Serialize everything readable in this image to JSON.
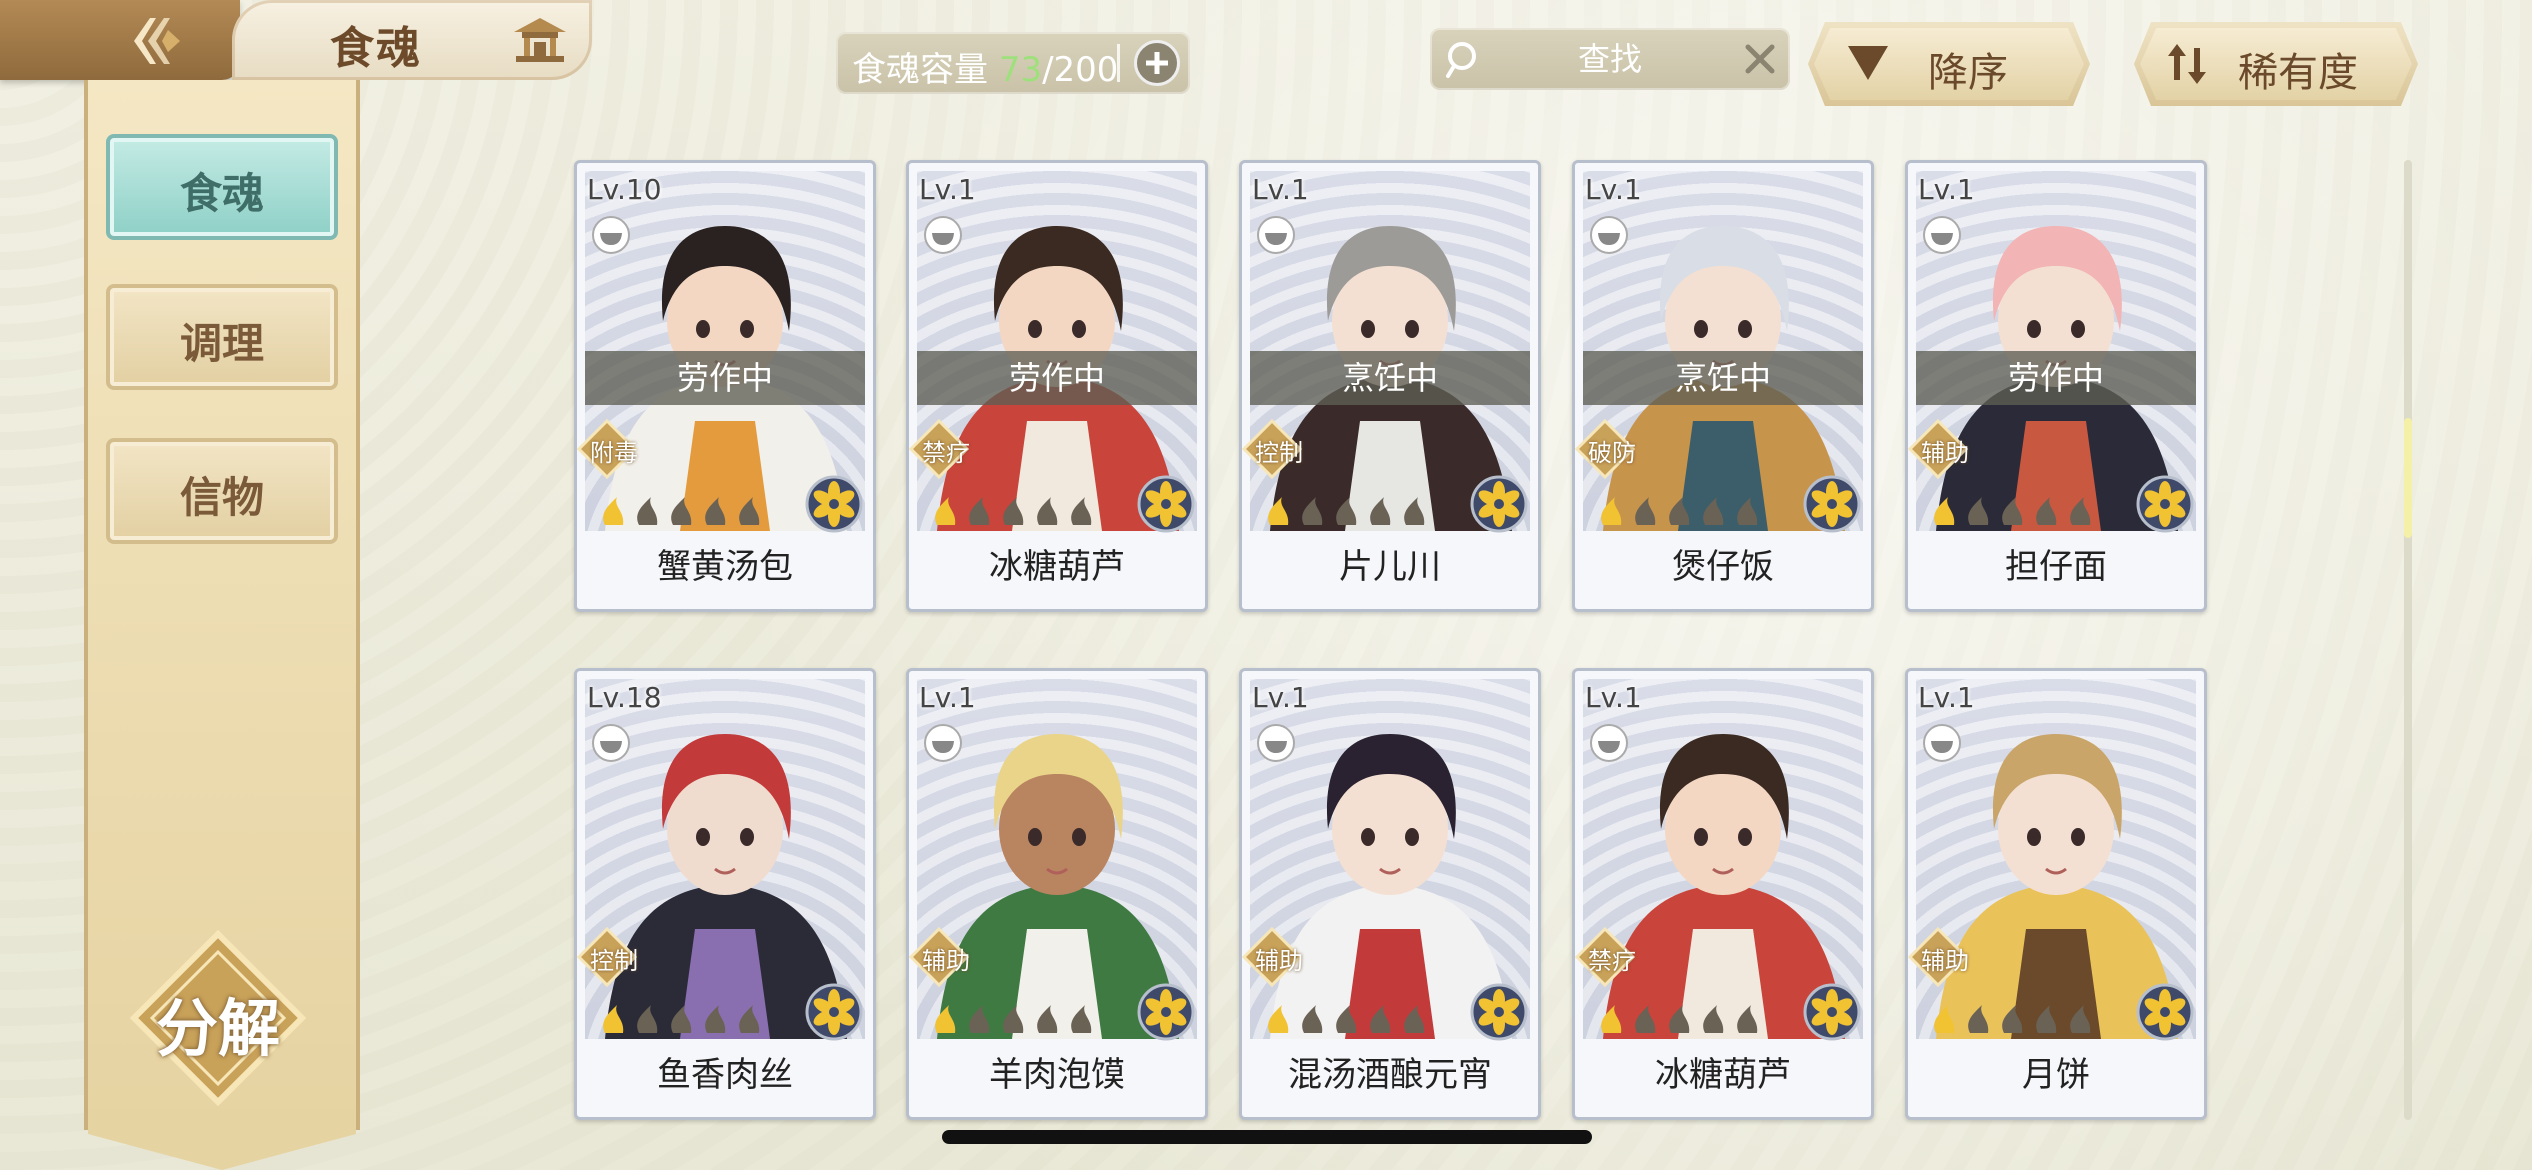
{
  "header": {
    "title": "食魂",
    "capacity_label": "食魂容量",
    "capacity_current": "73",
    "capacity_max": "/200",
    "search_placeholder": "查找",
    "sort_order_label": "降序",
    "sort_rarity_label": "稀有度"
  },
  "sidebar": {
    "items": [
      {
        "label": "食魂",
        "active": true
      },
      {
        "label": "调理",
        "active": false
      },
      {
        "label": "信物",
        "active": false
      }
    ],
    "decompose_label": "分解"
  },
  "cards": [
    {
      "level": "Lv.10",
      "name": "蟹黄汤包",
      "status": "劳作中",
      "role": "附毒",
      "stars": 1,
      "palette": [
        "#f2f0ea",
        "#e49b3e",
        "#2a2220",
        "#f4d7c2"
      ]
    },
    {
      "level": "Lv.1",
      "name": "冰糖葫芦",
      "status": "劳作中",
      "role": "禁疗",
      "stars": 1,
      "palette": [
        "#c9443a",
        "#f1e8de",
        "#3b2a22",
        "#f4d7c2"
      ]
    },
    {
      "level": "Lv.1",
      "name": "片儿川",
      "status": "烹饪中",
      "role": "控制",
      "stars": 1,
      "palette": [
        "#3a2a2a",
        "#e6e6e2",
        "#9d9b98",
        "#f4e0d2"
      ]
    },
    {
      "level": "Lv.1",
      "name": "煲仔饭",
      "status": "烹饪中",
      "role": "破防",
      "stars": 1,
      "palette": [
        "#c7944c",
        "#3b5e6a",
        "#d9dde6",
        "#f4e0d2"
      ]
    },
    {
      "level": "Lv.1",
      "name": "担仔面",
      "status": "劳作中",
      "role": "辅助",
      "stars": 1,
      "palette": [
        "#2a2a38",
        "#c95840",
        "#f2b4b4",
        "#f4e0d2"
      ]
    },
    {
      "level": "Lv.18",
      "name": "鱼香肉丝",
      "status": "",
      "role": "控制",
      "stars": 1,
      "palette": [
        "#2b2b38",
        "#8a6fb0",
        "#c23a3a",
        "#f0dccf"
      ]
    },
    {
      "level": "Lv.1",
      "name": "羊肉泡馍",
      "status": "",
      "role": "辅助",
      "stars": 1,
      "palette": [
        "#3f7a42",
        "#f2f0ea",
        "#e9d48a",
        "#b98460"
      ]
    },
    {
      "level": "Lv.1",
      "name": "混汤酒酿元宵",
      "status": "",
      "role": "辅助",
      "stars": 1,
      "palette": [
        "#f2f2f2",
        "#c23a3a",
        "#2a2230",
        "#f4e0d2"
      ]
    },
    {
      "level": "Lv.1",
      "name": "冰糖葫芦",
      "status": "",
      "role": "禁疗",
      "stars": 1,
      "palette": [
        "#c9443a",
        "#f1e8de",
        "#3b2a22",
        "#f4d7c2"
      ]
    },
    {
      "level": "Lv.1",
      "name": "月饼",
      "status": "",
      "role": "辅助",
      "stars": 1,
      "palette": [
        "#e9c25a",
        "#6a4a2a",
        "#c9a56a",
        "#f4e0d2"
      ]
    }
  ],
  "colors": {
    "active_tab": "#8ccfc5",
    "gold": "#c9a25a",
    "capacity_current": "#9ee07c"
  }
}
